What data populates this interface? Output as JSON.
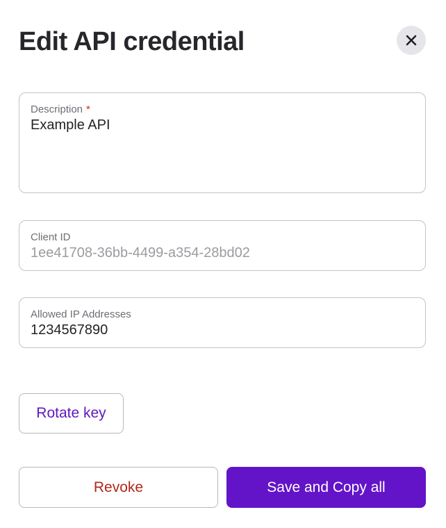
{
  "dialog": {
    "title": "Edit API credential",
    "close_icon": "close-icon"
  },
  "fields": {
    "description": {
      "label": "Description",
      "required_mark": "*",
      "value": "Example API"
    },
    "client_id": {
      "label": "Client ID",
      "value": "1ee41708-36bb-4499-a354-28bd02"
    },
    "allowed_ips": {
      "label": "Allowed IP Addresses",
      "value": "1234567890"
    }
  },
  "actions": {
    "rotate_label": "Rotate key",
    "revoke_label": "Revoke",
    "save_label": "Save and Copy all"
  },
  "colors": {
    "accent": "#6314c9",
    "danger_text": "#b0271c",
    "required": "#d22a1e",
    "close_bg": "#e6e6ea"
  }
}
